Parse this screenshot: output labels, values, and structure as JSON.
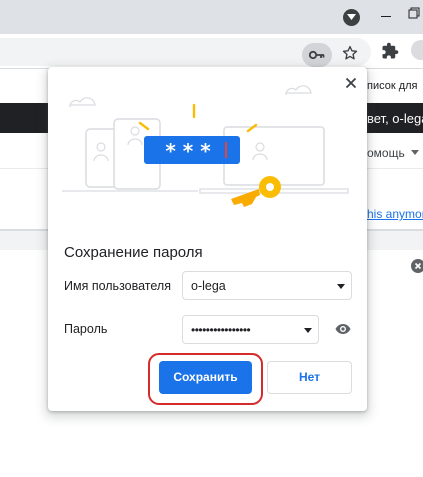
{
  "browser": {
    "icons": {
      "profile": "chevron-down-circle-icon",
      "minimize": "minimize-icon",
      "restore": "restore-icon",
      "password_key": "key-icon",
      "bookmark": "star-icon",
      "extensions": "puzzle-icon"
    }
  },
  "page_background": {
    "top_text": "писок для",
    "dark_bar_text": "вет, o-lega",
    "help_text": "омощь",
    "link_text": "his anymore"
  },
  "dialog": {
    "title": "Сохранение пароля",
    "username_label": "Имя пользователя",
    "username_value": "o-lega",
    "password_label": "Пароль",
    "password_value": "••••••••••••••••",
    "save_label": "Сохранить",
    "no_label": "Нет",
    "illustration_stars": "* * *",
    "icons": {
      "close": "close-icon",
      "show_password": "eye-icon"
    }
  },
  "colors": {
    "accent": "#1a73e8",
    "highlight_ring": "#d62b2b",
    "key_gold": "#fbbc04",
    "dark_bar": "#202124"
  }
}
